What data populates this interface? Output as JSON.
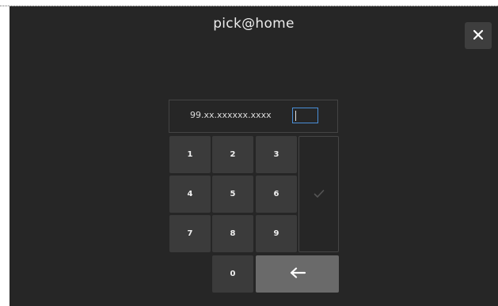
{
  "header": {
    "title": "pick@home"
  },
  "close_button": {
    "icon": "close-icon",
    "glyph": "✕"
  },
  "entry": {
    "value": "99.xx.xxxxxx.xxxx",
    "input_value": ""
  },
  "keypad": {
    "keys": [
      "1",
      "2",
      "3",
      "4",
      "5",
      "6",
      "7",
      "8",
      "9",
      "0"
    ],
    "confirm_icon": "check-icon",
    "backspace_icon": "backspace-arrow-icon"
  },
  "colors": {
    "background": "#262626",
    "key": "#3b3b3b",
    "backspace_key": "#6a6a6a",
    "focus_border": "#4a8fd8"
  }
}
